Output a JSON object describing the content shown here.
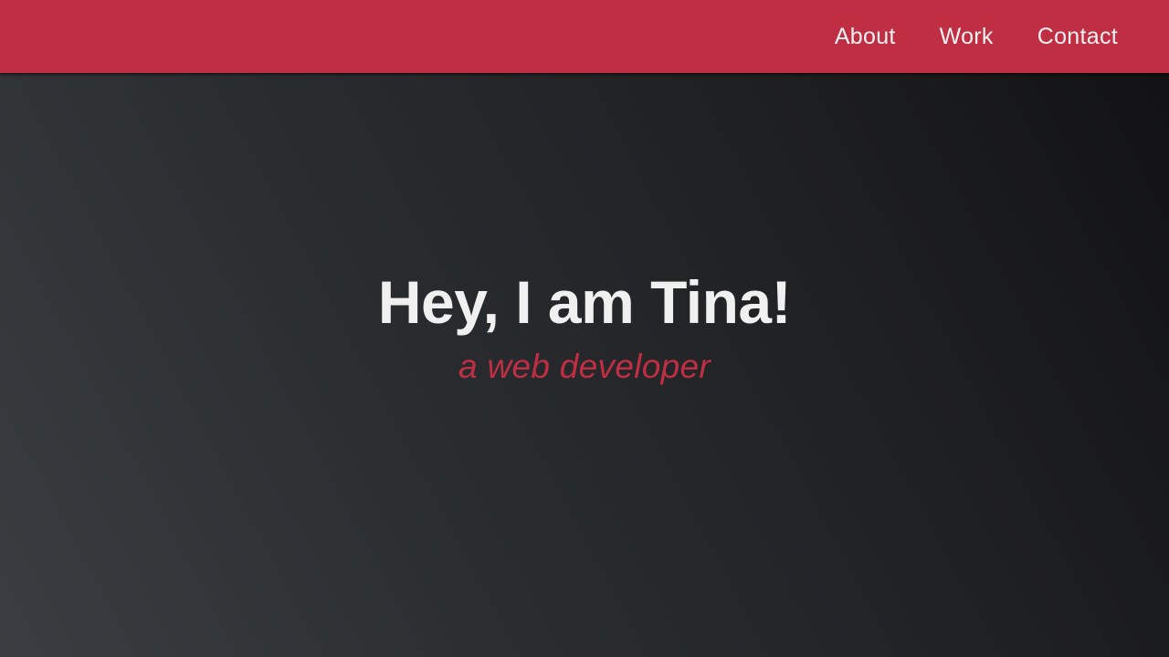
{
  "nav": {
    "links": [
      {
        "label": "About"
      },
      {
        "label": "Work"
      },
      {
        "label": "Contact"
      }
    ]
  },
  "hero": {
    "title": "Hey, I am Tina!",
    "subtitle": "a web developer"
  },
  "colors": {
    "accent": "#c02e44",
    "text_light": "#f0f0f0",
    "background_dark": "#1e1f21"
  }
}
